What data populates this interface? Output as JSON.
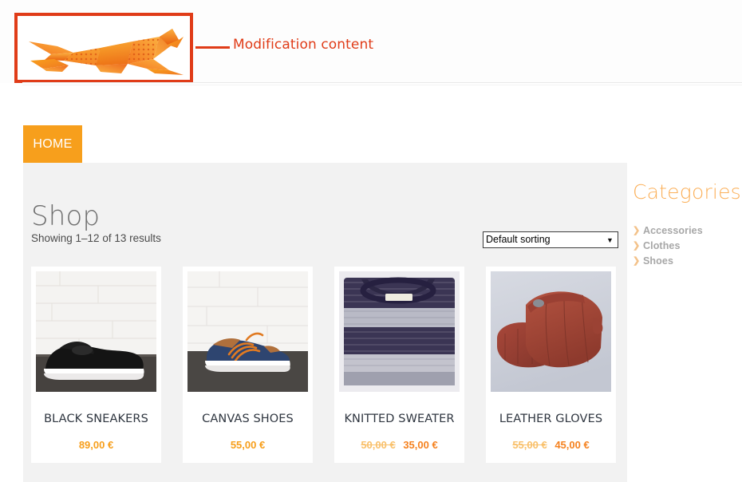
{
  "annotation": {
    "label": "Modification content",
    "color": "#e03c18"
  },
  "header": {
    "logo_alt": "origami-cheetah-logo"
  },
  "nav": {
    "home_label": "HOME",
    "home_color": "#f79f1c"
  },
  "shop": {
    "title": "Shop",
    "result_count": "Showing 1–12 of 13 results",
    "sorting": {
      "selected": "Default sorting",
      "options": [
        "Default sorting"
      ]
    }
  },
  "products": [
    {
      "title": "BLACK SNEAKERS",
      "price": "89,00 €",
      "old_price": "",
      "on_sale": false,
      "image_alt": "black-sneakers-photo"
    },
    {
      "title": "CANVAS SHOES",
      "price": "55,00 €",
      "old_price": "",
      "on_sale": false,
      "image_alt": "canvas-shoes-photo"
    },
    {
      "title": "KNITTED SWEATER",
      "price": "35,00 €",
      "old_price": "50,00 €",
      "on_sale": true,
      "image_alt": "knitted-sweater-photo"
    },
    {
      "title": "LEATHER GLOVES",
      "price": "45,00 €",
      "old_price": "55,00 €",
      "on_sale": true,
      "image_alt": "leather-gloves-photo"
    }
  ],
  "sidebar": {
    "title": "Categories",
    "title_color": "#fbb05a",
    "categories": [
      {
        "label": "Accessories"
      },
      {
        "label": "Clothes"
      },
      {
        "label": "Shoes"
      }
    ]
  }
}
